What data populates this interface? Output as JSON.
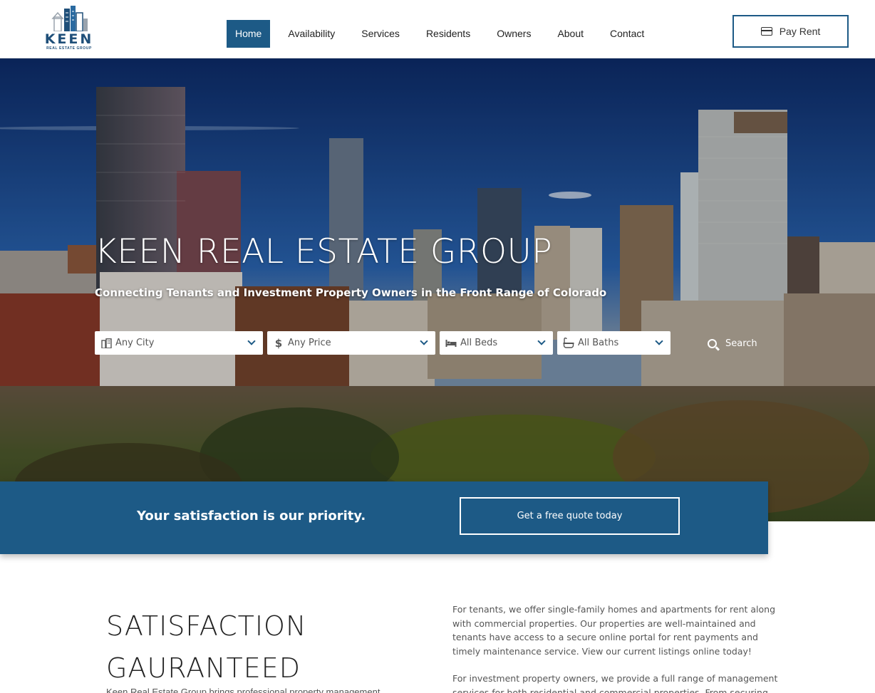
{
  "brand": {
    "logo_word": "KEEN",
    "logo_sub": "REAL ESTATE GROUP"
  },
  "nav": {
    "items": [
      {
        "label": "Home",
        "active": true
      },
      {
        "label": "Availability",
        "active": false
      },
      {
        "label": "Services",
        "active": false
      },
      {
        "label": "Residents",
        "active": false
      },
      {
        "label": "Owners",
        "active": false
      },
      {
        "label": "About",
        "active": false
      },
      {
        "label": "Contact",
        "active": false
      }
    ],
    "pay_rent": {
      "label": "Pay Rent",
      "icon": "credit-card-icon"
    }
  },
  "hero": {
    "title": "KEEN REAL ESTATE GROUP",
    "subtitle": "Connecting Tenants and Investment Property Owners in the Front Range of Colorado",
    "filters": {
      "city": {
        "value": "Any City",
        "icon": "building-icon"
      },
      "price": {
        "value": "Any Price",
        "icon": "dollar-icon"
      },
      "beds": {
        "value": "All Beds",
        "icon": "bed-icon"
      },
      "baths": {
        "value": "All Baths",
        "icon": "bathtub-icon"
      }
    },
    "search_label": "Search"
  },
  "cta": {
    "text": "Your satisfaction is our priority.",
    "button": "Get a free quote today"
  },
  "content": {
    "heading_line1": "SATISFACTION",
    "heading_line2": "GAURANTEED",
    "left_para": "Keen Real Estate Group brings professional property management",
    "right_para1": "For tenants, we offer single-family homes and apartments for rent along with commercial properties. Our properties are well-maintained and tenants have access to a secure online portal for rent payments and timely maintenance service. View our current listings online today!",
    "right_para2": "For investment property owners, we provide a full range of management services for both residential and commercial properties. From securing qualified"
  },
  "colors": {
    "brand_blue": "#1d5a86",
    "header_bg": "#ffffff",
    "text_dark": "#222222"
  }
}
